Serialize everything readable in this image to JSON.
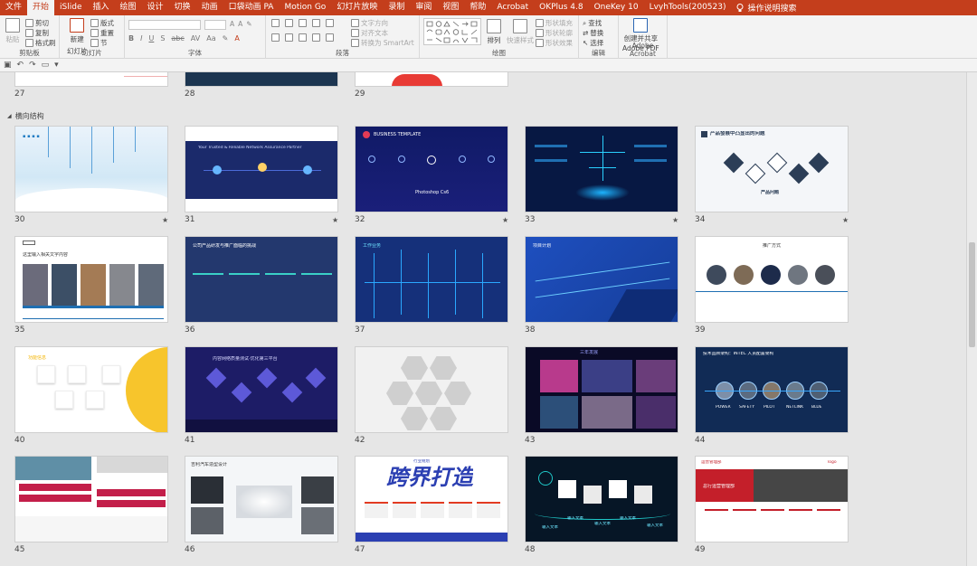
{
  "menubar": {
    "tabs": [
      "文件",
      "开始",
      "iSlide",
      "插入",
      "绘图",
      "设计",
      "切换",
      "动画",
      "口袋动画 PA",
      "Motion Go",
      "幻灯片放映",
      "录制",
      "审阅",
      "视图",
      "帮助",
      "Acrobat",
      "OKPlus 4.8",
      "OneKey 10",
      "LvyhTools(200523)"
    ],
    "tell_me": "操作说明搜索"
  },
  "ribbon": {
    "clipboard": {
      "label": "剪贴板",
      "paste": "粘贴",
      "cut": "剪切",
      "copy": "复制",
      "format_painter": "格式刷"
    },
    "slides": {
      "label": "幻灯片",
      "new_slide": "新建",
      "new_slide2": "幻灯片",
      "layout": "版式",
      "reset": "重置",
      "section": "节"
    },
    "font": {
      "label": "字体"
    },
    "paragraph": {
      "label": "段落",
      "text_direction": "文字方向",
      "align_text": "对齐文本",
      "smartart": "转换为 SmartArt"
    },
    "drawing": {
      "label": "绘图",
      "arrange": "排列",
      "quick_styles": "快速样式",
      "shape_fill": "形状填充",
      "shape_outline": "形状轮廓",
      "shape_effects": "形状效果"
    },
    "editing": {
      "label": "编辑",
      "find": "查找",
      "replace": "替换",
      "select": "选择"
    },
    "acrobat": {
      "label": "Adobe Acrobat",
      "create_line1": "创建并共享",
      "create_line2": "Adobe PDF"
    }
  },
  "sorter": {
    "section_name": "横向结构",
    "top_row_numbers": [
      "27",
      "28",
      "29"
    ],
    "slides": [
      {
        "num": "30",
        "star": true
      },
      {
        "num": "31",
        "star": true
      },
      {
        "num": "32",
        "star": true
      },
      {
        "num": "33",
        "star": true
      },
      {
        "num": "34",
        "star": true
      },
      {
        "num": "35",
        "star": false
      },
      {
        "num": "36",
        "star": false
      },
      {
        "num": "37",
        "star": false
      },
      {
        "num": "38",
        "star": false
      },
      {
        "num": "39",
        "star": false
      },
      {
        "num": "40",
        "star": false
      },
      {
        "num": "41",
        "star": false
      },
      {
        "num": "42",
        "star": false
      },
      {
        "num": "43",
        "star": false
      },
      {
        "num": "44",
        "star": false
      },
      {
        "num": "45",
        "star": false
      },
      {
        "num": "46",
        "star": false
      },
      {
        "num": "47",
        "star": false
      },
      {
        "num": "48",
        "star": false
      },
      {
        "num": "49",
        "star": false
      }
    ],
    "star_glyph": "★"
  },
  "slide_text": {
    "s32_title": "BUSINESS TEMPLATE",
    "s32_sub": "Photoshop Cs6",
    "s31_title": "Your Trusted & Reliable Network Assurance Partner",
    "s34_title": "产品發展中凸显出的问题",
    "s34_mid": "产品问题",
    "s35_title": "这里输入相关文字内容",
    "s36_title": "公司产品研发与推广面临的挑战",
    "s37_title": "工作业务",
    "s38_title": "项目计划",
    "s39_title": "推广方式",
    "s40_title": "功能信息",
    "s41_title": "内容网络质量测试·优化第三平台",
    "s43_title": "三年发展",
    "s44_title": "技术品牌架构：INTEC 人员配置架构",
    "s44_labels": [
      "POWER",
      "SAFETY",
      "PILOT",
      "NETLINK",
      "BLUE"
    ],
    "s46_title": "吉利汽车造型设计",
    "s47_title": "跨界打造",
    "s47_tag": "行业规划",
    "s48_labels": [
      "输入文本",
      "输入文本",
      "输入文本",
      "输入文本",
      "输入文本"
    ],
    "s49_title": "总行运营管理部",
    "s49_top": "运营管理部",
    "s49_logo": "logo"
  },
  "colors": {
    "accent": "#c43e1c",
    "ribbon_bg": "#f3f3f3",
    "sorter_bg": "#e6e6e6"
  }
}
